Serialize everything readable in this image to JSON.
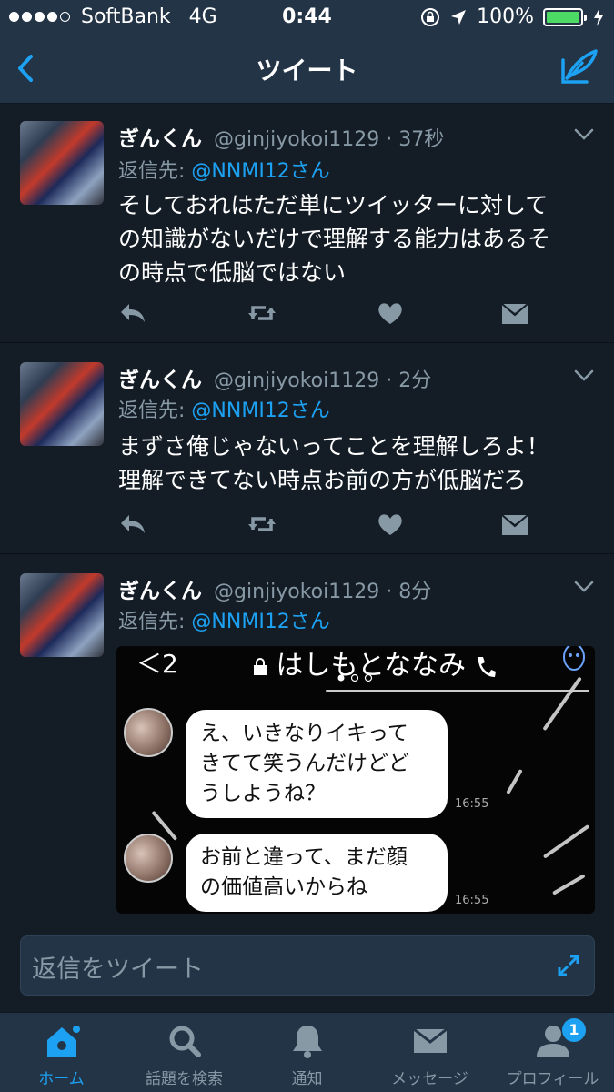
{
  "status_bar": {
    "carrier": "SoftBank",
    "network": "4G",
    "time": "0:44",
    "battery": "100%",
    "battery_level": 1.0,
    "signal_bars_filled": 4,
    "signal_bars_total": 5
  },
  "nav": {
    "title": "ツイート",
    "back_icon": "chevron-left-icon",
    "compose_icon": "compose-tweet-icon"
  },
  "colors": {
    "background": "#141d26",
    "bar": "#243447",
    "accent": "#1da1f2",
    "muted": "#8899a6"
  },
  "reply_prefix": "返信先:",
  "tweets": [
    {
      "name": "ぎんくん",
      "meta": "@ginjiyokoi1129 · 37秒",
      "reply_handle": "@NNMI12さん",
      "text_lines": [
        "そしておれはただ単にツイッターに対して",
        "の知識がないだけで理解する能力はあるそ",
        "の時点で低脳ではない"
      ]
    },
    {
      "name": "ぎんくん",
      "meta": "@ginjiyokoi1129 · 2分",
      "reply_handle": "@NNMI12さん",
      "text_lines": [
        "まずさ俺じゃないってことを理解しろよ！",
        "理解できてない時点お前の方が低脳だろ"
      ]
    },
    {
      "name": "ぎんくん",
      "meta": "@ginjiyokoi1129 · 8分",
      "reply_handle": "@NNMI12さん",
      "text_lines": []
    }
  ],
  "media": {
    "chat_back": "＜2",
    "chat_title": "はしもとななみ",
    "messages": [
      {
        "lines": [
          "え、いきなりイキって",
          "きてて笑うんだけどど",
          "うしようね？"
        ],
        "time": "16:55"
      },
      {
        "lines": [
          "お前と違って、まだ顔",
          "の価値高いからね"
        ],
        "time": "16:55"
      }
    ]
  },
  "reply_box": {
    "placeholder": "返信をツイート"
  },
  "tabs": [
    {
      "label": "ホーム",
      "icon": "home-icon",
      "active": true
    },
    {
      "label": "話題を検索",
      "icon": "search-icon",
      "active": false
    },
    {
      "label": "通知",
      "icon": "bell-icon",
      "active": false
    },
    {
      "label": "メッセージ",
      "icon": "envelope-icon",
      "active": false
    },
    {
      "label": "プロフィール",
      "icon": "profile-icon",
      "active": false,
      "badge": "1"
    }
  ]
}
